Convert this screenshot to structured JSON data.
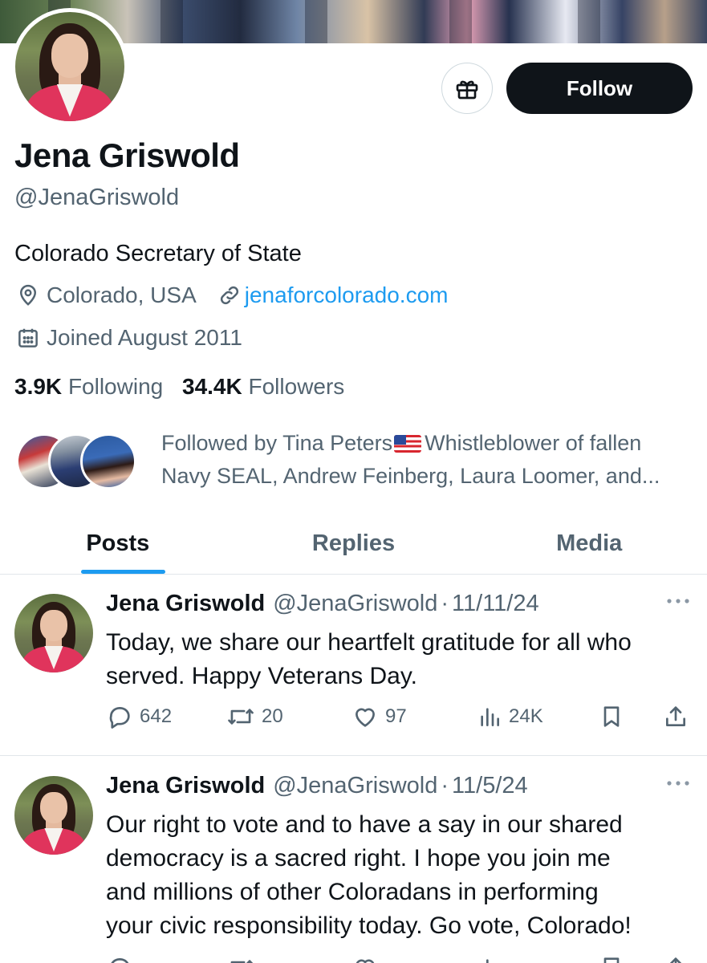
{
  "profile": {
    "name": "Jena Griswold",
    "handle": "@JenaGriswold",
    "bio": "Colorado Secretary of State",
    "location": "Colorado, USA",
    "website": "jenaforcolorado.com",
    "joined": "Joined August 2011",
    "following_count": "3.9K",
    "following_label": "Following",
    "followers_count": "34.4K",
    "followers_label": "Followers",
    "follow_button": "Follow",
    "followed_by_line1_a": "Followed by Tina Peters",
    "followed_by_line1_b": "Whistleblower of fallen",
    "followed_by_line2": "Navy SEAL, Andrew Feinberg, Laura Loomer, and..."
  },
  "tabs": [
    "Posts",
    "Replies",
    "Media"
  ],
  "active_tab": "Posts",
  "colors": {
    "accent": "#1d9bf0",
    "text_primary": "#0f1419",
    "text_secondary": "#536471",
    "follow_button_bg": "#0f1419"
  },
  "tweets": [
    {
      "name": "Jena Griswold",
      "handle": "@JenaGriswold",
      "date": "11/11/24",
      "text_lines": [
        "Today, we share our heartfelt gratitude for all who",
        "served. Happy Veterans Day."
      ],
      "replies": "642",
      "retweets": "20",
      "likes": "97",
      "views": "24K"
    },
    {
      "name": "Jena Griswold",
      "handle": "@JenaGriswold",
      "date": "11/5/24",
      "text_lines": [
        "Our right to vote and to have a say in our shared",
        "democracy is a sacred right. I hope you join me",
        "and millions of other Coloradans in performing",
        "your civic responsibility today. Go vote, Colorado!"
      ]
    }
  ],
  "icons": [
    "gift-icon",
    "location-pin-icon",
    "link-icon",
    "calendar-icon",
    "more-icon",
    "reply-icon",
    "retweet-icon",
    "like-icon",
    "views-icon",
    "bookmark-icon",
    "share-icon"
  ]
}
